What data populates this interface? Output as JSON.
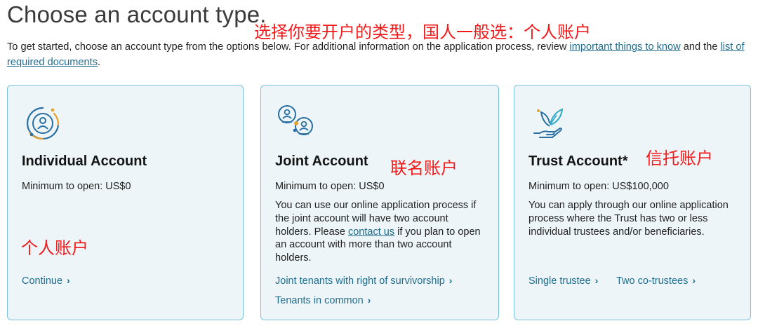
{
  "page": {
    "title": "Choose an account type.",
    "intro_text": "To get started, choose an account type from the options below. For additional information on the application process, review ",
    "intro_link1": "important things to know",
    "intro_mid": " and the ",
    "intro_link2": "list of required documents",
    "intro_end": "."
  },
  "annotations": {
    "top": "选择你要开户的类型，国人一般选：个人账户",
    "joint": "联名账户",
    "trust": "信托账户",
    "individual": "个人账户"
  },
  "cards": {
    "individual": {
      "icon": "person-circle-icon",
      "title": "Individual Account",
      "minimum": "Minimum to open: US$0",
      "link": "Continue"
    },
    "joint": {
      "icon": "two-people-icon",
      "title": "Joint Account",
      "minimum": "Minimum to open: US$0",
      "desc_before": "You can use our online application process if the joint account will have two account holders. Please ",
      "desc_link": "contact us",
      "desc_after": " if you plan to open an account with more than two account holders.",
      "link1": "Joint tenants with right of survivorship",
      "link2": "Tenants in common"
    },
    "trust": {
      "icon": "hand-leaf-icon",
      "title": "Trust Account*",
      "minimum": "Minimum to open: US$100,000",
      "desc": "You can apply through our online application process where the Trust has two or less individual trustees and/or beneficiaries.",
      "link1": "Single trustee",
      "link2": "Two co-trustees"
    }
  },
  "colors": {
    "accent_link": "#1f6d8e",
    "card_border": "#79c2dc",
    "card_bg": "#edf5f8",
    "annotation_red": "#f21a1a"
  }
}
